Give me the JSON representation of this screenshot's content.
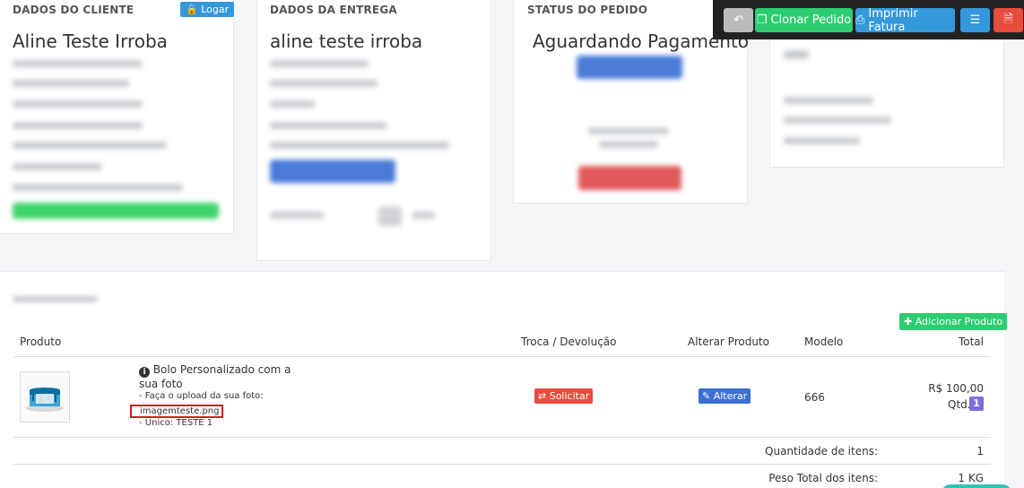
{
  "customer": {
    "title": "DADOS DO CLIENTE",
    "login_label": "Logar",
    "name": "Aline Teste Irroba"
  },
  "delivery": {
    "title": "DADOS DA ENTREGA",
    "name": "aline teste irroba"
  },
  "status": {
    "title": "STATUS DO PEDIDO",
    "value": "Aguardando Pagamento"
  },
  "toolbar": {
    "back_icon": "reply-icon",
    "clone_label": "Clonar Pedido",
    "print_label": "Imprimir Fatura",
    "list_icon": "list-icon",
    "pdf_icon": "pdf-icon"
  },
  "products": {
    "add_label": "Adicionar Produto",
    "columns": {
      "product": "Produto",
      "exchange": "Troca / Devolução",
      "change": "Alterar Produto",
      "model": "Modelo",
      "total": "Total"
    },
    "row": {
      "name": "Bolo Personalizado com a sua foto",
      "option_upload_label": "- Faça o upload da sua foto:",
      "option_upload_file": "imagemteste.png",
      "option_unique": "- Único: TESTE 1",
      "request_label": "Solicitar",
      "change_label": "Alterar",
      "model": "666",
      "price": "R$ 100,00",
      "qty_label": "Qtd.",
      "qty": "1"
    },
    "summary": [
      {
        "label": "Quantidade de itens:",
        "value": "1"
      },
      {
        "label": "Peso Total dos itens:",
        "value": "1 KG"
      }
    ]
  },
  "colors": {
    "green": "#2ecc71",
    "blue": "#3498db",
    "red": "#e74c3c",
    "purple": "#7e6ddb",
    "gray": "#bbbbbb"
  }
}
